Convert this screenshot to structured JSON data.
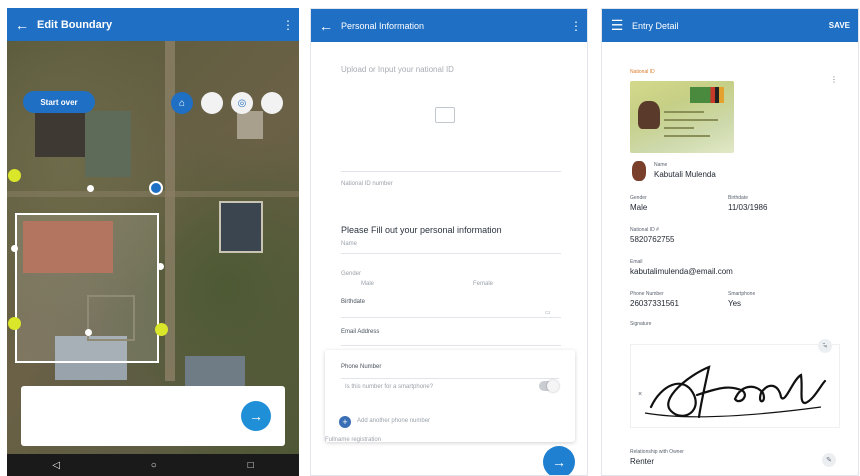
{
  "screen1": {
    "title": "Edit Boundary",
    "back_icon": "arrow-left-icon",
    "menu_icon": "more-vert-icon",
    "start_button": "Start over",
    "map_tools": [
      "home-icon",
      "circle-icon",
      "target-icon",
      "circle-icon"
    ],
    "bottom_hint": "",
    "next_icon": "arrow-right-icon",
    "nav": [
      "◁",
      "○",
      "□"
    ]
  },
  "screen2": {
    "title": "Personal Information",
    "upload_label": "Upload or Input your national ID",
    "national_id_label": "National ID number",
    "section_heading": "Please Fill out your personal information",
    "name_label": "Name",
    "gender_label": "Gender",
    "gender_options": [
      "Male",
      "Female"
    ],
    "birthdate_label": "Birthdate",
    "email_label": "Email Address",
    "phone_label": "Phone Number",
    "phone_question": "Is this number for a smartphone?",
    "add_phone": "Add another phone number",
    "footer": "Fullname registration",
    "next_icon": "arrow-right-icon"
  },
  "screen3": {
    "title": "Entry Detail",
    "save": "SAVE",
    "national_id_label": "National ID",
    "name_label": "Name",
    "name_value": "Kabutali Mulenda",
    "gender_label": "Gender",
    "gender_value": "Male",
    "birthdate_label": "Birthdate",
    "birthdate_value": "11/03/1986",
    "national_id_no_label": "National ID #",
    "national_id_no_value": "5820762755",
    "email_label": "Email",
    "email_value": "kabutalimulenda@email.com",
    "phone_label": "Phone Number",
    "phone_value": "26037331561",
    "smartphone_label": "Smartphone",
    "smartphone_value": "Yes",
    "signature_label": "Signature",
    "relationship_label": "Relationship with Owner",
    "relationship_value": "Renter"
  },
  "colors": {
    "primary": "#1f6fc4",
    "accent_fab": "#1f8fd8",
    "vertex_yellow": "#d9e62a",
    "label_orange": "#d97d2b"
  }
}
